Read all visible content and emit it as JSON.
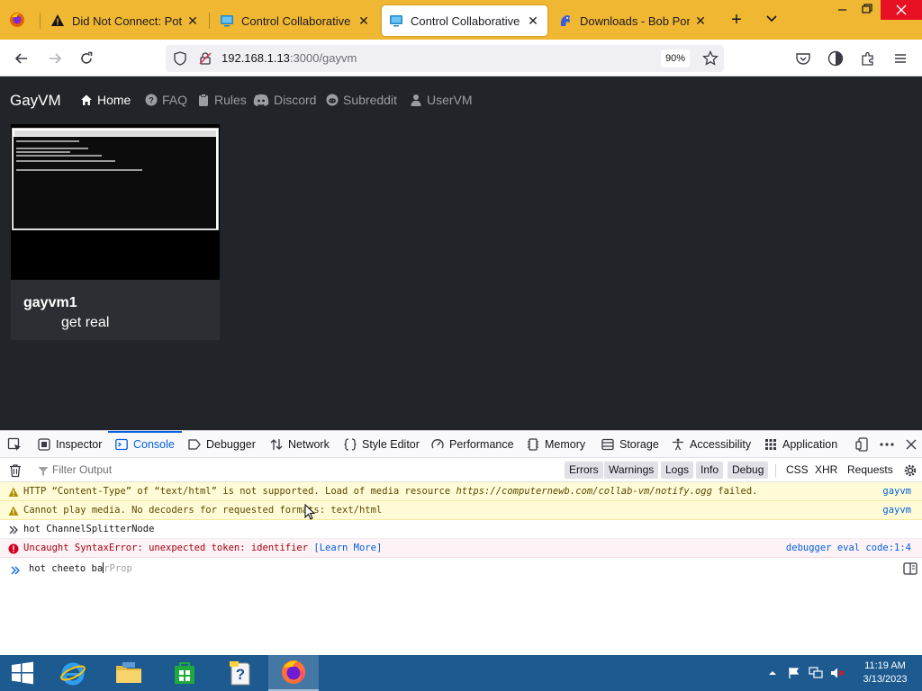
{
  "browser": {
    "tabs": [
      {
        "label": "Did Not Connect: Potent",
        "icon": "warning-icon",
        "active": false
      },
      {
        "label": "Control Collaborative Vir",
        "icon": "monitor-icon",
        "active": false
      },
      {
        "label": "Control Collaborative Vir",
        "icon": "monitor-icon",
        "active": true
      },
      {
        "label": "Downloads - Bob Pony",
        "icon": "pony-icon",
        "active": false
      }
    ],
    "new_tab": "+",
    "url_host": "192.168.1.13",
    "url_rest": ":3000/gayvm",
    "zoom": "90%"
  },
  "site": {
    "brand": "GayVM",
    "nav": [
      {
        "label": "Home",
        "icon": "home-icon"
      },
      {
        "label": "FAQ",
        "icon": "question-icon"
      },
      {
        "label": "Rules",
        "icon": "clipboard-icon"
      },
      {
        "label": "Discord",
        "icon": "discord-icon"
      },
      {
        "label": "Subreddit",
        "icon": "reddit-icon"
      },
      {
        "label": "UserVM",
        "icon": "user-icon"
      }
    ],
    "vm": {
      "name": "gayvm1",
      "description": "get real"
    }
  },
  "devtools": {
    "tabs": [
      {
        "label": "Inspector",
        "icon": "inspector-icon"
      },
      {
        "label": "Console",
        "icon": "console-icon"
      },
      {
        "label": "Debugger",
        "icon": "debugger-icon"
      },
      {
        "label": "Network",
        "icon": "network-icon"
      },
      {
        "label": "Style Editor",
        "icon": "style-editor-icon"
      },
      {
        "label": "Performance",
        "icon": "performance-icon"
      },
      {
        "label": "Memory",
        "icon": "memory-icon"
      },
      {
        "label": "Storage",
        "icon": "storage-icon"
      },
      {
        "label": "Accessibility",
        "icon": "accessibility-icon"
      },
      {
        "label": "Application",
        "icon": "application-icon"
      }
    ],
    "active_tab": "Console",
    "filter_placeholder": "Filter Output",
    "filters": [
      "Errors",
      "Warnings",
      "Logs",
      "Info",
      "Debug"
    ],
    "active_filters": [
      "Errors",
      "Warnings",
      "Logs",
      "Info",
      "Debug"
    ],
    "extra_filters": [
      "CSS",
      "XHR",
      "Requests"
    ],
    "messages": [
      {
        "type": "warn",
        "pre": "HTTP “Content-Type” of “text/html” is not supported. Load of media resource ",
        "em": "https://computernewb.com/collab-vm/notify.ogg",
        "post": " failed.",
        "source": "gayvm"
      },
      {
        "type": "warn",
        "pre": "Cannot play media. No decoders for requested formats: text/html",
        "em": "",
        "post": "",
        "source": "gayvm"
      },
      {
        "type": "input",
        "pre": "hot ChannelSplitterNode",
        "em": "",
        "post": "",
        "source": ""
      },
      {
        "type": "error",
        "pre": "Uncaught SyntaxError: unexpected token: identifier ",
        "em": "[Learn More]",
        "post": "",
        "source": "debugger eval code:1:4"
      }
    ],
    "input_typed": "hot cheeto ba",
    "input_hint": "rProp"
  },
  "taskbar": {
    "time": "11:19 AM",
    "date": "3/13/2023"
  }
}
